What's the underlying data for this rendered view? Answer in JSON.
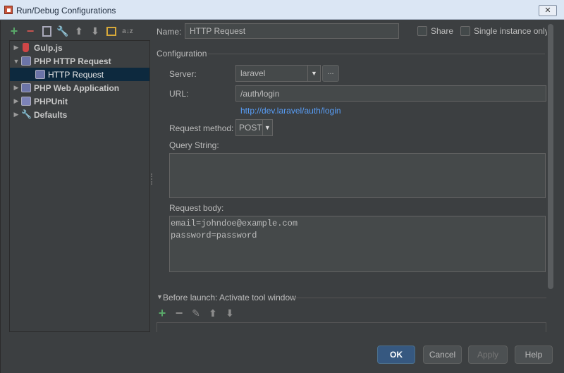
{
  "window": {
    "title": "Run/Debug Configurations",
    "close_glyph": "✕"
  },
  "toolbar": {
    "icons": [
      "add-icon",
      "remove-icon",
      "copy-icon",
      "wrench-icon",
      "move-up-icon",
      "move-down-icon",
      "folder-icon",
      "sort-icon"
    ],
    "add": "+",
    "remove": "−",
    "up": "⬆",
    "down": "⬇",
    "sort": "a↓z"
  },
  "tree": {
    "items": [
      {
        "label": "Gulp.js",
        "expanded": false
      },
      {
        "label": "PHP HTTP Request",
        "expanded": true
      },
      {
        "label": "HTTP Request",
        "selected": true
      },
      {
        "label": "PHP Web Application",
        "expanded": false
      },
      {
        "label": "PHPUnit",
        "expanded": false
      },
      {
        "label": "Defaults",
        "expanded": false
      }
    ],
    "collapsed_arrow": "▶",
    "expanded_arrow": "▼"
  },
  "form": {
    "name_label": "Name:",
    "name_value": "HTTP Request",
    "share_label": "Share",
    "single_instance_label": "Single instance only",
    "configuration_title": "Configuration",
    "server_label": "Server:",
    "server_value": "laravel",
    "server_more": "...",
    "url_label": "URL:",
    "url_value": "/auth/login",
    "full_url": "http://dev.laravel/auth/login",
    "method_label": "Request method:",
    "method_value": "POST",
    "query_label": "Query String:",
    "query_value": "",
    "body_label": "Request body:",
    "body_lines": [
      "email=johndoe@example.com",
      "password=password"
    ],
    "before_launch_title": "Before launch: Activate tool window",
    "bl_add": "+",
    "bl_remove": "−",
    "bl_edit": "✎",
    "bl_up": "⬆",
    "bl_down": "⬇"
  },
  "buttons": {
    "ok": "OK",
    "cancel": "Cancel",
    "apply": "Apply",
    "help": "Help"
  },
  "colors": {
    "background": "#3c3f41",
    "selection": "#0d293e",
    "link": "#589df6",
    "primary": "#365880",
    "add": "#59a869",
    "remove": "#c75450"
  }
}
